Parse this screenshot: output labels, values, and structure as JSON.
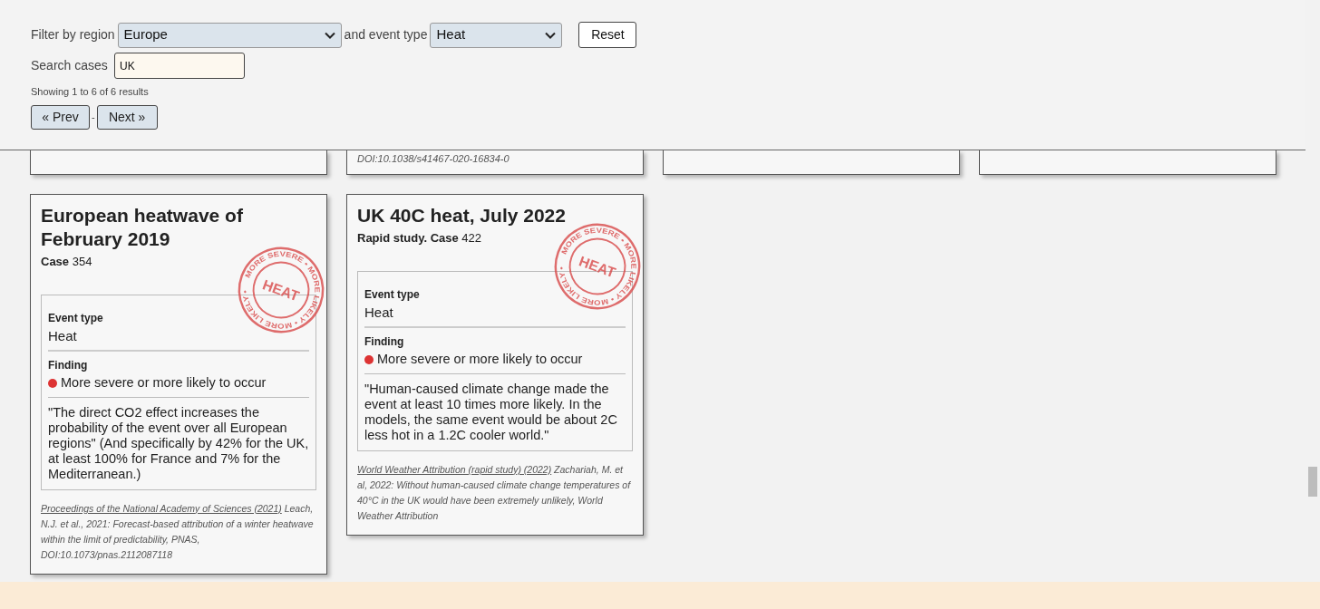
{
  "filters": {
    "region_label": "Filter by region",
    "region": "Europe",
    "event_label": "and event type",
    "event": "Heat",
    "reset": "Reset",
    "search_label": "Search cases",
    "search_value": "UK",
    "showing": "Showing 1 to 6 of 6 results",
    "prev": "« Prev",
    "separator": "-",
    "next": "Next »"
  },
  "clipped_cards": [
    {
      "kind": "card"
    },
    {
      "kind": "card",
      "tail": "DOI:10.1038/s41467-020-16834-0"
    },
    {
      "kind": "card"
    },
    {
      "kind": "card"
    }
  ],
  "cards": [
    {
      "title": "European heatwave of February 2019",
      "case_label": "Case",
      "case_number": "354",
      "stamp": {
        "center": "HEAT",
        "ring": "MORE SEVERE • MORE LIKELY • MORE LIKELY •"
      },
      "event_type_label": "Event type",
      "event_type": "Heat",
      "finding_label": "Finding",
      "finding": "More severe or more likely to occur",
      "finding_dot": {
        "color": "#dd3333"
      },
      "quote": "\"The direct CO2 effect increases the probability of the event over all European regions\" (And specifically by 42% for the UK, at least 100% for France and 7% for the Mediterranean.)",
      "source_link": "Proceedings of the National Academy of Sciences (2021)",
      "source_text": "Leach, N.J. et al., 2021: Forecast-based attribution of a winter heatwave within the limit of predictability, PNAS, DOI:10.1073/pnas.2112087118"
    },
    {
      "title": "UK 40C heat, July 2022",
      "case_label": "Rapid study. Case",
      "case_number": "422",
      "stamp": {
        "center": "HEAT",
        "ring": "MORE SEVERE • MORE LIKELY • MORE LIKELY •"
      },
      "event_type_label": "Event type",
      "event_type": "Heat",
      "finding_label": "Finding",
      "finding": "More severe or more likely to occur",
      "finding_dot": {
        "color": "#dd3333"
      },
      "quote": "\"Human-caused climate change made the event at least 10 times more likely. In the models, the same event would be about 2C less hot in a 1.2C cooler world.\"",
      "source_link": "World Weather Attribution (rapid study) (2022)",
      "source_text": "Zachariah, M. et al, 2022: Without human-caused climate change temperatures of 40°C in the UK would have been extremely unlikely, World Weather Attribution"
    }
  ]
}
